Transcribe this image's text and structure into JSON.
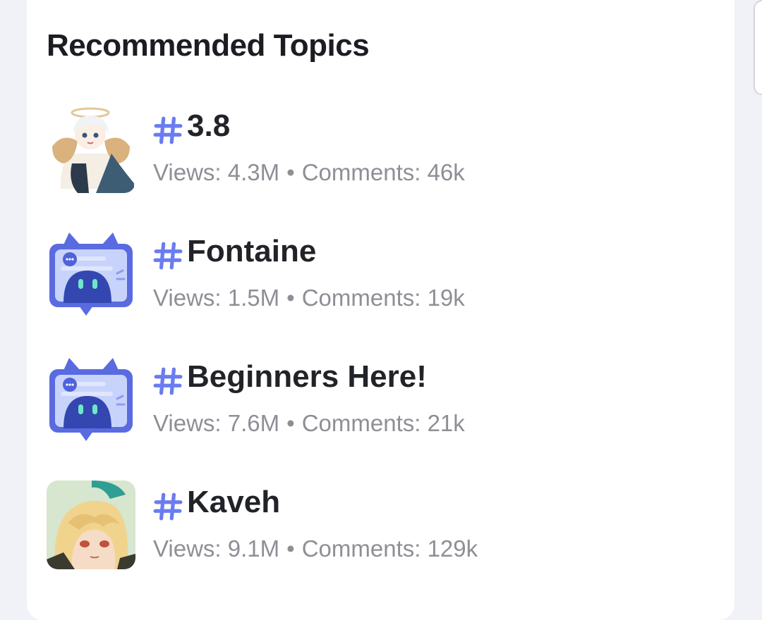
{
  "section": {
    "title": "Recommended Topics"
  },
  "topics": [
    {
      "icon": "paimon-avatar-icon",
      "title": "3.8",
      "views_label": "Views: 4.3M",
      "separator": "•",
      "comments_label": "Comments: 46k"
    },
    {
      "icon": "chat-bot-icon",
      "title": "Fontaine",
      "views_label": "Views: 1.5M",
      "separator": "•",
      "comments_label": "Comments: 19k"
    },
    {
      "icon": "chat-bot-icon",
      "title": "Beginners Here!",
      "views_label": "Views: 7.6M",
      "separator": "•",
      "comments_label": "Comments: 21k"
    },
    {
      "icon": "kaveh-avatar-icon",
      "title": "Kaveh",
      "views_label": "Views: 9.1M",
      "separator": "•",
      "comments_label": "Comments: 129k"
    }
  ],
  "colors": {
    "accent": "#6a7cf0",
    "title_text": "#222328",
    "meta_text": "#8e8f96",
    "card_bg": "#ffffff",
    "page_bg": "#f1f2f7"
  }
}
